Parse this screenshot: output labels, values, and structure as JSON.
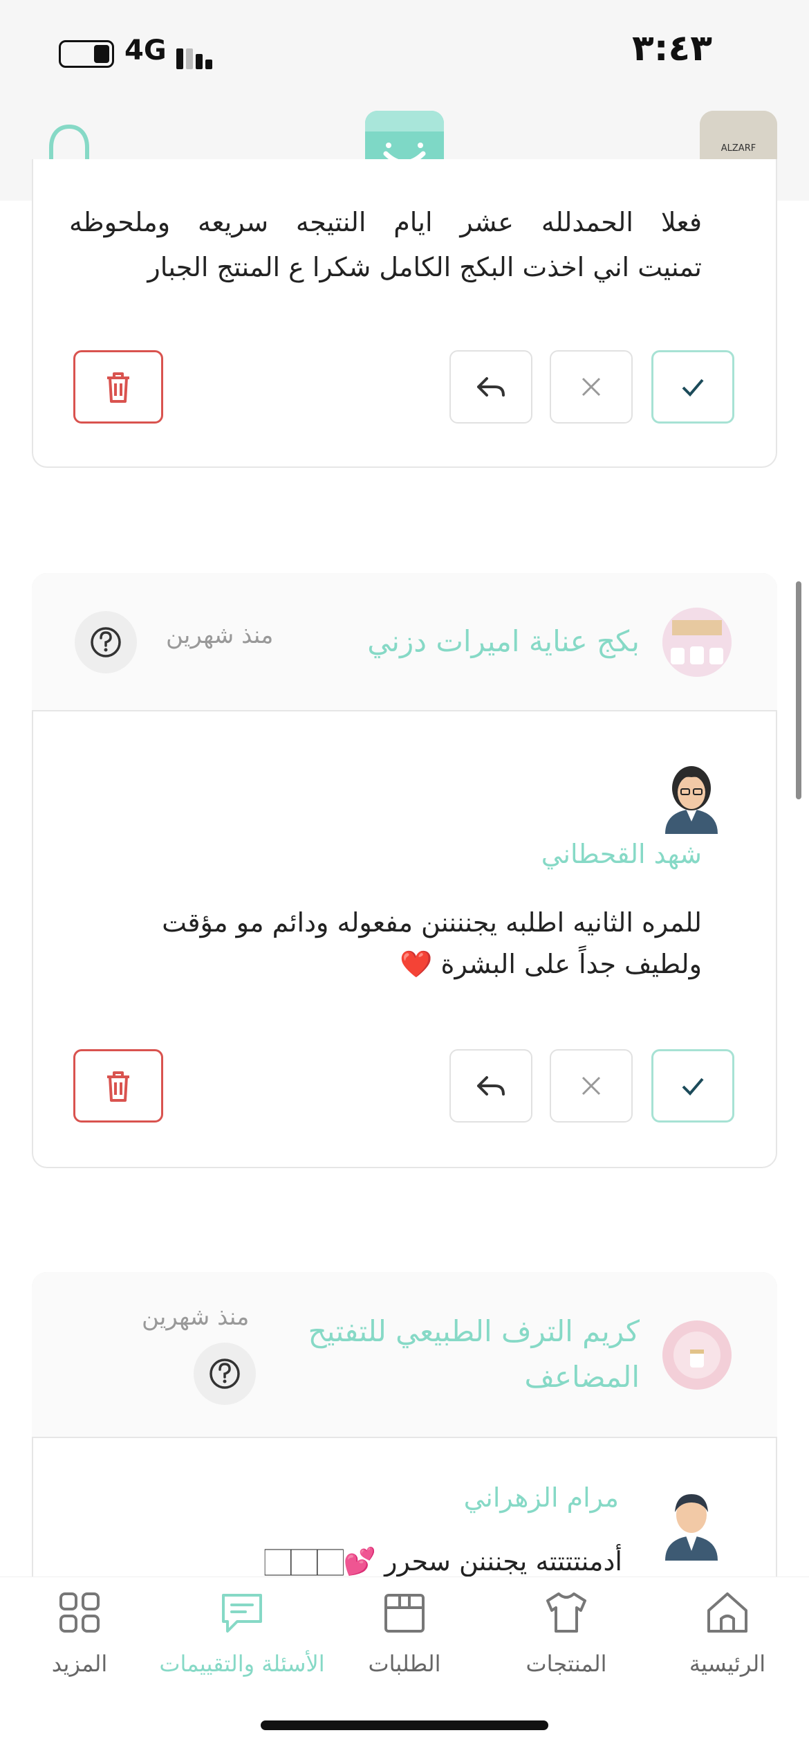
{
  "status": {
    "time": "٣:٤٣",
    "network": "4G"
  },
  "cards": [
    {
      "text_line1": "فعلا الحمدلله عشر ايام النتيجه سريعه وملحوظه",
      "text_line2": "تمنيت اني اخذت البكج الكامل شكرا ع المنتج الجبار"
    },
    {
      "product_title": "بكج عناية اميرات دزني",
      "since": "منذ شهرين",
      "reviewer": "شهد القحطاني",
      "text_line1": "للمره الثانيه اطلبه يجننننن مفعوله ودائم مو مؤقت",
      "text_line2": "ولطيف جداً على البشرة ❤️"
    },
    {
      "product_title_line1": "كريم الترف الطبيعي للتفتيح",
      "product_title_line2": "المضاعف",
      "since": "منذ شهرين",
      "reviewer": "مرام الزهراني",
      "text_line1": "أدمنتتتته يجنننن سحرر 💕🏻🏻🏻"
    }
  ],
  "nav": [
    {
      "label": "الرئيسية",
      "icon": "home-icon"
    },
    {
      "label": "المنتجات",
      "icon": "shirt-icon"
    },
    {
      "label": "الطلبات",
      "icon": "box-icon"
    },
    {
      "label": "الأسئلة والتقييمات",
      "icon": "chat-icon",
      "active": true
    },
    {
      "label": "المزيد",
      "icon": "grid-icon"
    }
  ],
  "colors": {
    "accent": "#86d9c6",
    "danger": "#d9534f",
    "logo": "#7ed8c6"
  }
}
